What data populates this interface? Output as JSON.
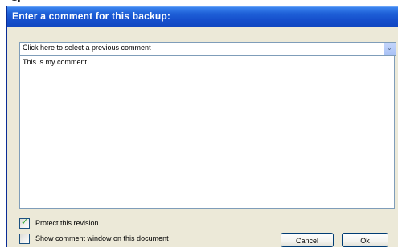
{
  "window": {
    "title": "Enter a comment for this backup:"
  },
  "comment_select": {
    "selected": "Click here to select a previous comment"
  },
  "comment_text": {
    "value": "This is my comment."
  },
  "options": {
    "protect_label": "Protect this revision",
    "protect_checked": true,
    "show_window_label": "Show comment window on this document",
    "show_window_checked": false
  },
  "buttons": {
    "cancel": "Cancel",
    "ok": "Ok"
  },
  "icons": {
    "dropdown": "chevron-down-icon",
    "check": "checkmark-icon"
  }
}
